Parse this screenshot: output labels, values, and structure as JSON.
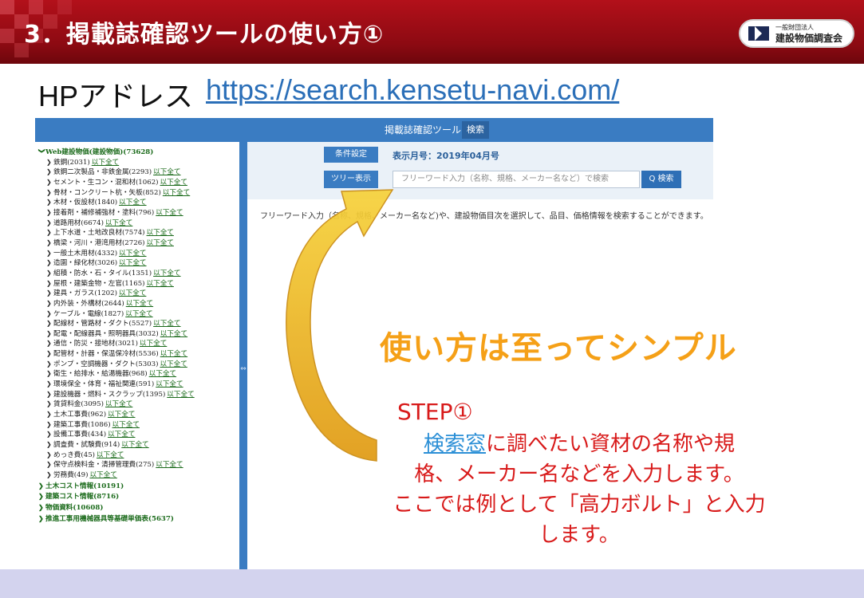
{
  "slide": {
    "title": "3．掲載誌確認ツールの使い方①",
    "logo_small": "一般財団法人",
    "logo_big": "建設物価調査会",
    "hp_label": "HPアドレス",
    "hp_url": "https://search.kensetu-navi.com/"
  },
  "app": {
    "title": "掲載誌確認ツール",
    "top_button": "検索",
    "cond_button": "条件設定",
    "month_label": "表示月号：2019年04月号",
    "tree_button": "ツリー表示",
    "search_placeholder": "フリーワード入力（名称、規格、メーカー名など）で検索",
    "search_button": "Q 検索",
    "description": "フリーワード入力（名称、規格、メーカー名など)や、建設物価目次を選択して、品目、価格情報を検索することができます。",
    "link_label": "以下全て",
    "tree": [
      {
        "label": "Web建設物価(建設物価)(73628)",
        "root": true,
        "expanded": true
      },
      {
        "label": "鉄鋼(2031)",
        "root": false
      },
      {
        "label": "鉄鋼二次製品・非鉄金属(2293)",
        "root": false
      },
      {
        "label": "セメント・生コン・混和材(1062)",
        "root": false
      },
      {
        "label": "骨材・コンクリート杭・矢板(852)",
        "root": false
      },
      {
        "label": "木材・仮設材(1840)",
        "root": false
      },
      {
        "label": "接着剤・補修補強材・塗料(796)",
        "root": false
      },
      {
        "label": "道路用材(6674)",
        "root": false
      },
      {
        "label": "上下水道・土地改良材(7574)",
        "root": false
      },
      {
        "label": "橋梁・河川・港湾用材(2726)",
        "root": false
      },
      {
        "label": "一般土木用材(4332)",
        "root": false
      },
      {
        "label": "造園・緑化材(3026)",
        "root": false
      },
      {
        "label": "組積・防水・石・タイル(1351)",
        "root": false
      },
      {
        "label": "屋根・建築金物・左官(1165)",
        "root": false
      },
      {
        "label": "建具・ガラス(1202)",
        "root": false
      },
      {
        "label": "内外装・外構材(2644)",
        "root": false
      },
      {
        "label": "ケーブル・電線(1827)",
        "root": false
      },
      {
        "label": "配線材・管路材・ダクト(5527)",
        "root": false
      },
      {
        "label": "配電・配線器具・照明器具(3032)",
        "root": false
      },
      {
        "label": "通信・防災・接地材(3021)",
        "root": false
      },
      {
        "label": "配管材・計器・保温保冷材(5536)",
        "root": false
      },
      {
        "label": "ポンプ・空調機器・ダクト(5303)",
        "root": false
      },
      {
        "label": "衛生・給排水・給湯機器(968)",
        "root": false
      },
      {
        "label": "環境保全・体育・福祉関連(591)",
        "root": false
      },
      {
        "label": "建設機器・燃料・スクラップ(1395)",
        "root": false
      },
      {
        "label": "賃貸料金(3095)",
        "root": false
      },
      {
        "label": "土木工事費(962)",
        "root": false
      },
      {
        "label": "建築工事費(1086)",
        "root": false
      },
      {
        "label": "設備工事費(434)",
        "root": false
      },
      {
        "label": "調査費・試験費(914)",
        "root": false
      },
      {
        "label": "めっき費(45)",
        "root": false
      },
      {
        "label": "保守点検料金・清掃管理費(275)",
        "root": false
      },
      {
        "label": "労務費(49)",
        "root": false
      },
      {
        "label": "土木コスト情報(10191)",
        "root": true,
        "expanded": false
      },
      {
        "label": "建築コスト情報(8716)",
        "root": true,
        "expanded": false
      },
      {
        "label": "物価資料(10608)",
        "root": true,
        "expanded": false
      },
      {
        "label": "推進工事用機械器具等基礎単価表(5637)",
        "root": true,
        "expanded": false
      }
    ]
  },
  "callout": {
    "headline": "使い方は至ってシンプル",
    "step": "STEP①",
    "keyword": "検索窓",
    "body_1": "に調べたい資材の名称や規",
    "body_2": "格、メーカー名などを入力します。",
    "body_3": "ここでは例として「高力ボルト」と入力",
    "body_4": "します。"
  },
  "colors": {
    "header_red": "#9e0e16",
    "app_blue": "#3a7cc2",
    "headline_orange": "#f5a017",
    "body_red": "#d81a1a",
    "keyword_blue": "#2b8fd6",
    "footer_lavender": "#d3d3ee"
  }
}
